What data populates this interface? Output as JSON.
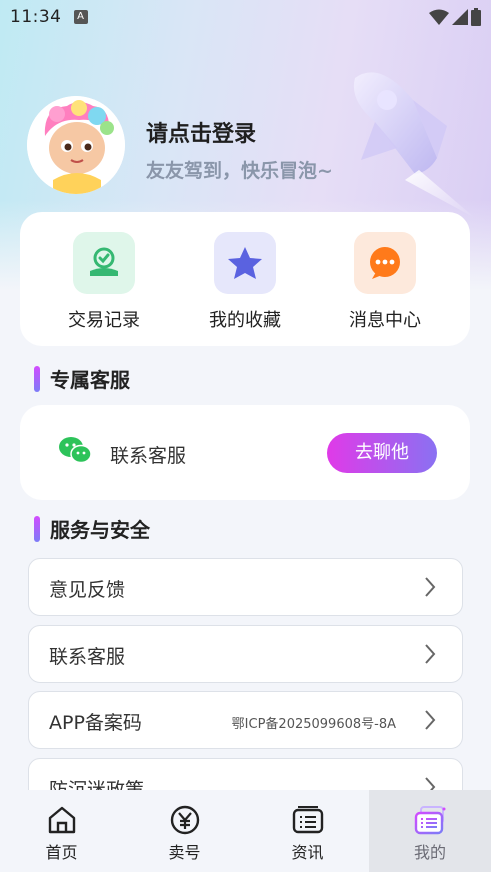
{
  "status_bar": {
    "time": "11:34",
    "notification_icon": "A"
  },
  "profile": {
    "title": "请点击登录",
    "subtitle": "友友驾到，快乐冒泡~"
  },
  "quick_actions": [
    {
      "label": "交易记录",
      "icon": "handshake-icon",
      "bg": "#dff6ea",
      "color": "#35b872"
    },
    {
      "label": "我的收藏",
      "icon": "star-icon",
      "bg": "#e6e7fb",
      "color": "#5a62e0"
    },
    {
      "label": "消息中心",
      "icon": "chat-bubble-icon",
      "bg": "#fde9dc",
      "color": "#ff7a1a"
    }
  ],
  "sections": {
    "exclusive_service": "专属客服",
    "service_security": "服务与安全"
  },
  "service_card": {
    "label": "联系客服",
    "button": "去聊他",
    "icon": "wechat-icon"
  },
  "menu_rows": [
    {
      "label": "意见反馈",
      "value": ""
    },
    {
      "label": "联系客服",
      "value": ""
    },
    {
      "label": "APP备案码",
      "value": "鄂ICP备2025099608号-8A"
    },
    {
      "label": "防沉迷政策",
      "value": ""
    }
  ],
  "tabs": [
    {
      "label": "首页",
      "icon": "home-icon"
    },
    {
      "label": "卖号",
      "icon": "sell-yuan-icon"
    },
    {
      "label": "资讯",
      "icon": "news-icon"
    },
    {
      "label": "我的",
      "icon": "profile-cards-icon"
    }
  ],
  "colors": {
    "accent_gradient_start": "#e03ae8",
    "accent_gradient_end": "#8a71f2",
    "subtitle": "#8a96aa"
  }
}
